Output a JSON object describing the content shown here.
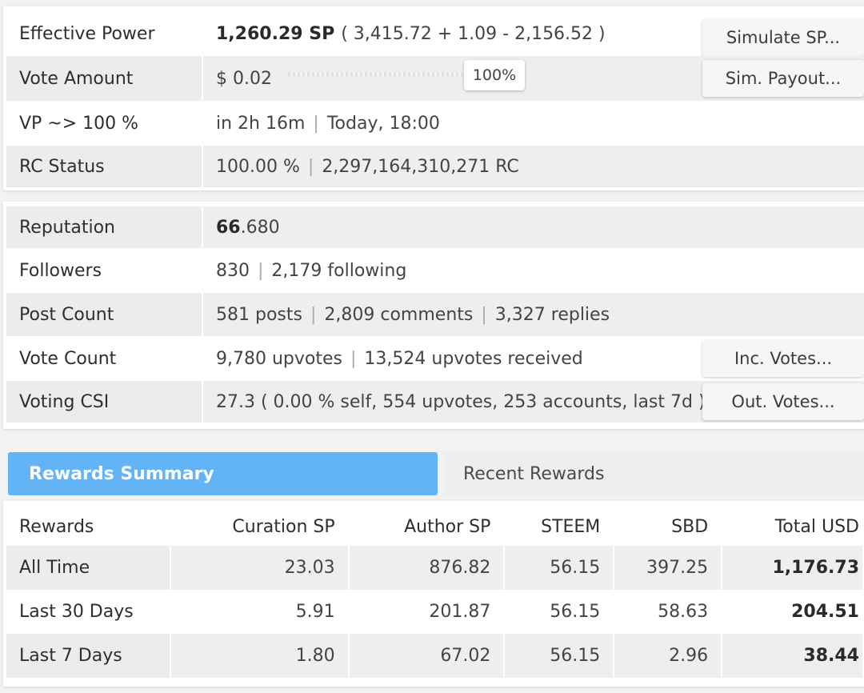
{
  "account": {
    "effective_power": {
      "label": "Effective Power",
      "value": "1,260.29 SP",
      "breakdown": "( 3,415.72 + 1.09 - 2,156.52 )",
      "button": "Simulate SP..."
    },
    "vote_amount": {
      "label": "Vote Amount",
      "value": "$ 0.02",
      "percent": "100%",
      "button": "Sim. Payout..."
    },
    "vp": {
      "label": "VP ~> 100 %",
      "time": "in 2h 16m",
      "sep": "|",
      "when": "Today, 18:00"
    },
    "rc_status": {
      "label": "RC Status",
      "percent": "100.00 %",
      "sep": "|",
      "amount": "2,297,164,310,271 RC"
    }
  },
  "stats": {
    "reputation": {
      "label": "Reputation",
      "major": "66",
      "minor": ".680"
    },
    "followers": {
      "label": "Followers",
      "count": "830",
      "sep": "|",
      "following": "2,179 following"
    },
    "post_count": {
      "label": "Post Count",
      "posts": "581 posts",
      "sep1": "|",
      "comments": "2,809 comments",
      "sep2": "|",
      "replies": "3,327 replies"
    },
    "vote_count": {
      "label": "Vote Count",
      "upvotes": "9,780 upvotes",
      "sep": "|",
      "received": "13,524 upvotes received",
      "button": "Inc. Votes..."
    },
    "voting_csi": {
      "label": "Voting CSI",
      "value": "27.3 ( 0.00 % self, 554 upvotes, 253 accounts, last 7d )",
      "button": "Out. Votes..."
    }
  },
  "tabs": {
    "active": "Rewards Summary",
    "inactive": "Recent Rewards"
  },
  "rewards": {
    "headers": [
      "Rewards",
      "Curation SP",
      "Author SP",
      "STEEM",
      "SBD",
      "Total USD"
    ],
    "rows": [
      [
        "All Time",
        "23.03",
        "876.82",
        "56.15",
        "397.25",
        "1,176.73"
      ],
      [
        "Last 30 Days",
        "5.91",
        "201.87",
        "56.15",
        "58.63",
        "204.51"
      ],
      [
        "Last 7 Days",
        "1.80",
        "67.02",
        "56.15",
        "2.96",
        "38.44"
      ]
    ]
  },
  "colors": {
    "active_tab": "#63b3f7",
    "row_shade": "#eeeeee",
    "background": "#f2f2f2"
  }
}
